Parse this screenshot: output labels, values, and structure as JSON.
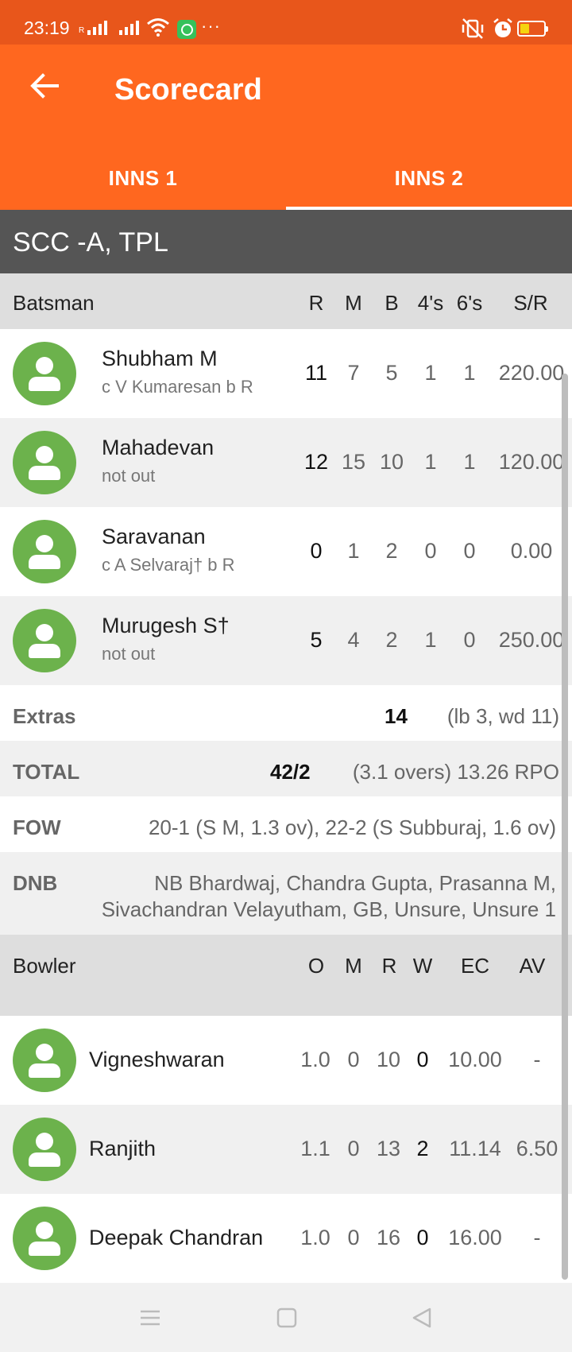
{
  "status_bar": {
    "time": "23:19",
    "signal_label": "R",
    "dots": "···",
    "battery_color": "#f5d40f"
  },
  "app_bar": {
    "title": "Scorecard",
    "back_icon": "arrow-left-icon",
    "color": "#ff671f"
  },
  "tabs": [
    {
      "label": "INNS 1",
      "active": false
    },
    {
      "label": "INNS 2",
      "active": true
    }
  ],
  "team": "SCC -A, TPL",
  "batting": {
    "header": [
      "Batsman",
      "R",
      "M",
      "B",
      "4's",
      "6's",
      "S/R"
    ],
    "rows": [
      {
        "name": "Shubham M",
        "dismissal": "c V Kumaresan b R",
        "r": "11",
        "m": "7",
        "b": "5",
        "fours": "1",
        "sixes": "1",
        "sr": "220.00"
      },
      {
        "name": "Mahadevan",
        "dismissal": "not out",
        "r": "12",
        "m": "15",
        "b": "10",
        "fours": "1",
        "sixes": "1",
        "sr": "120.00"
      },
      {
        "name": "Saravanan",
        "dismissal": "c A Selvaraj† b R",
        "r": "0",
        "m": "1",
        "b": "2",
        "fours": "0",
        "sixes": "0",
        "sr": "0.00"
      },
      {
        "name": "Murugesh S†",
        "dismissal": "not out",
        "r": "5",
        "m": "4",
        "b": "2",
        "fours": "1",
        "sixes": "0",
        "sr": "250.00"
      }
    ]
  },
  "extras": {
    "label": "Extras",
    "value": "14",
    "detail": "(lb 3, wd 11)"
  },
  "total": {
    "label": "TOTAL",
    "value": "42/2",
    "detail": "(3.1 overs) 13.26 RPO"
  },
  "fow": {
    "label": "FOW",
    "text": "20-1 (S M, 1.3 ov), 22-2 (S Subburaj, 1.6 ov)"
  },
  "dnb": {
    "label": "DNB",
    "line1": "NB Bhardwaj, Chandra Gupta, Prasanna M,",
    "line2": "Sivachandran Velayutham, GB, Unsure, Unsure 1"
  },
  "bowling": {
    "header": [
      "Bowler",
      "O",
      "M",
      "R",
      "W",
      "EC",
      "AV"
    ],
    "rows": [
      {
        "name": "Vigneshwaran",
        "o": "1.0",
        "m": "0",
        "r": "10",
        "w": "0",
        "ec": "10.00",
        "av": "-"
      },
      {
        "name": "Ranjith",
        "o": "1.1",
        "m": "0",
        "r": "13",
        "w": "2",
        "ec": "11.14",
        "av": "6.50"
      },
      {
        "name": "Deepak Chandran",
        "o": "1.0",
        "m": "0",
        "r": "16",
        "w": "0",
        "ec": "16.00",
        "av": "-"
      }
    ]
  },
  "nav": {
    "menu_icon": "menu-icon",
    "home_icon": "home-square-icon",
    "back_icon": "back-triangle-icon"
  }
}
